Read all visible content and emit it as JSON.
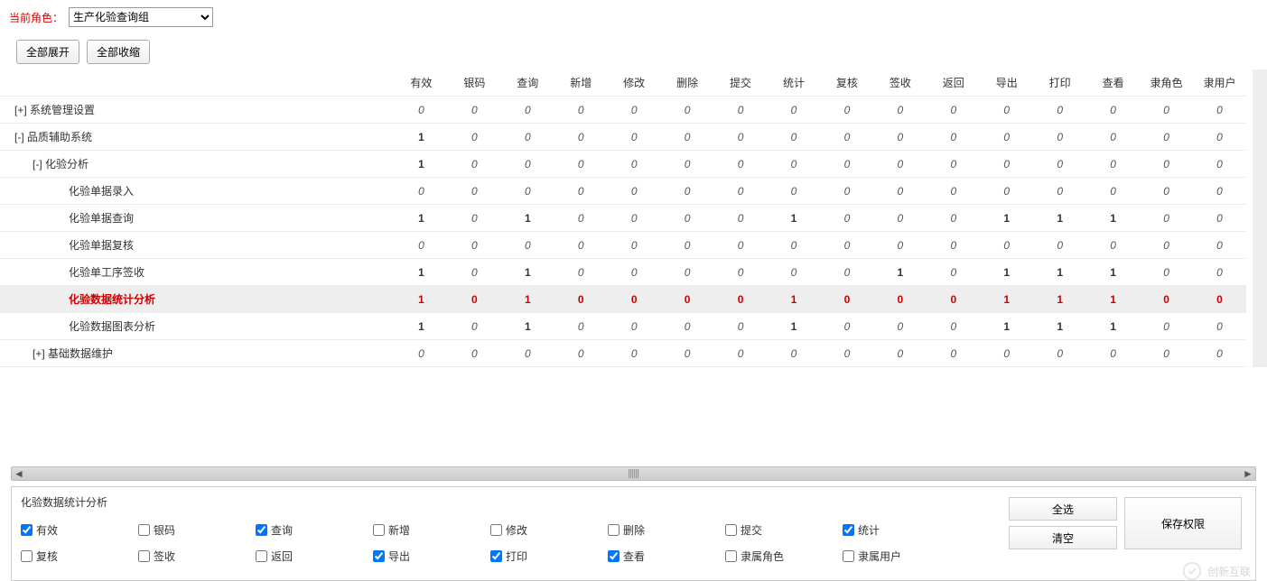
{
  "role": {
    "label": "当前角色：",
    "value": "生产化验查询组"
  },
  "buttons": {
    "expandAll": "全部展开",
    "collapseAll": "全部收缩",
    "selectAll": "全选",
    "clear": "清空",
    "save": "保存权限"
  },
  "columns": [
    "有效",
    "银码",
    "查询",
    "新增",
    "修改",
    "删除",
    "提交",
    "统计",
    "复核",
    "签收",
    "返回",
    "导出",
    "打印",
    "查看",
    "隶角色",
    "隶用户"
  ],
  "rows": [
    {
      "indent": 0,
      "toggle": "[+]",
      "name": "系统管理设置",
      "values": [
        0,
        0,
        0,
        0,
        0,
        0,
        0,
        0,
        0,
        0,
        0,
        0,
        0,
        0,
        0,
        0
      ],
      "boldFirst": false
    },
    {
      "indent": 0,
      "toggle": "[-]",
      "name": "品质辅助系统",
      "values": [
        1,
        0,
        0,
        0,
        0,
        0,
        0,
        0,
        0,
        0,
        0,
        0,
        0,
        0,
        0,
        0
      ],
      "boldFirst": true
    },
    {
      "indent": 1,
      "toggle": "[-]",
      "name": "化验分析",
      "values": [
        1,
        0,
        0,
        0,
        0,
        0,
        0,
        0,
        0,
        0,
        0,
        0,
        0,
        0,
        0,
        0
      ],
      "boldFirst": true
    },
    {
      "indent": 2,
      "toggle": "",
      "name": "化验单据录入",
      "values": [
        0,
        0,
        0,
        0,
        0,
        0,
        0,
        0,
        0,
        0,
        0,
        0,
        0,
        0,
        0,
        0
      ]
    },
    {
      "indent": 2,
      "toggle": "",
      "name": "化验单据查询",
      "values": [
        1,
        0,
        1,
        0,
        0,
        0,
        0,
        1,
        0,
        0,
        0,
        1,
        1,
        1,
        0,
        0
      ]
    },
    {
      "indent": 2,
      "toggle": "",
      "name": "化验单据复核",
      "values": [
        0,
        0,
        0,
        0,
        0,
        0,
        0,
        0,
        0,
        0,
        0,
        0,
        0,
        0,
        0,
        0
      ]
    },
    {
      "indent": 2,
      "toggle": "",
      "name": "化验单工序签收",
      "values": [
        1,
        0,
        1,
        0,
        0,
        0,
        0,
        0,
        0,
        1,
        0,
        1,
        1,
        1,
        0,
        0
      ]
    },
    {
      "indent": 2,
      "toggle": "",
      "name": "化验数据统计分析",
      "highlight": true,
      "values": [
        1,
        0,
        1,
        0,
        0,
        0,
        0,
        1,
        0,
        0,
        0,
        1,
        1,
        1,
        0,
        0
      ]
    },
    {
      "indent": 2,
      "toggle": "",
      "name": "化验数据图表分析",
      "values": [
        1,
        0,
        1,
        0,
        0,
        0,
        0,
        1,
        0,
        0,
        0,
        1,
        1,
        1,
        0,
        0
      ]
    },
    {
      "indent": 1,
      "toggle": "[+]",
      "name": "基础数据维护",
      "values": [
        0,
        0,
        0,
        0,
        0,
        0,
        0,
        0,
        0,
        0,
        0,
        0,
        0,
        0,
        0,
        0
      ]
    }
  ],
  "panel": {
    "title": "化验数据统计分析",
    "checks": [
      {
        "label": "有效",
        "checked": true
      },
      {
        "label": "银码",
        "checked": false
      },
      {
        "label": "查询",
        "checked": true
      },
      {
        "label": "新增",
        "checked": false
      },
      {
        "label": "修改",
        "checked": false
      },
      {
        "label": "删除",
        "checked": false
      },
      {
        "label": "提交",
        "checked": false
      },
      {
        "label": "统计",
        "checked": true
      },
      {
        "label": "复核",
        "checked": false
      },
      {
        "label": "签收",
        "checked": false
      },
      {
        "label": "返回",
        "checked": false
      },
      {
        "label": "导出",
        "checked": true
      },
      {
        "label": "打印",
        "checked": true
      },
      {
        "label": "查看",
        "checked": true
      },
      {
        "label": "隶属角色",
        "checked": false
      },
      {
        "label": "隶属用户",
        "checked": false
      }
    ]
  },
  "watermark": "创新互联"
}
